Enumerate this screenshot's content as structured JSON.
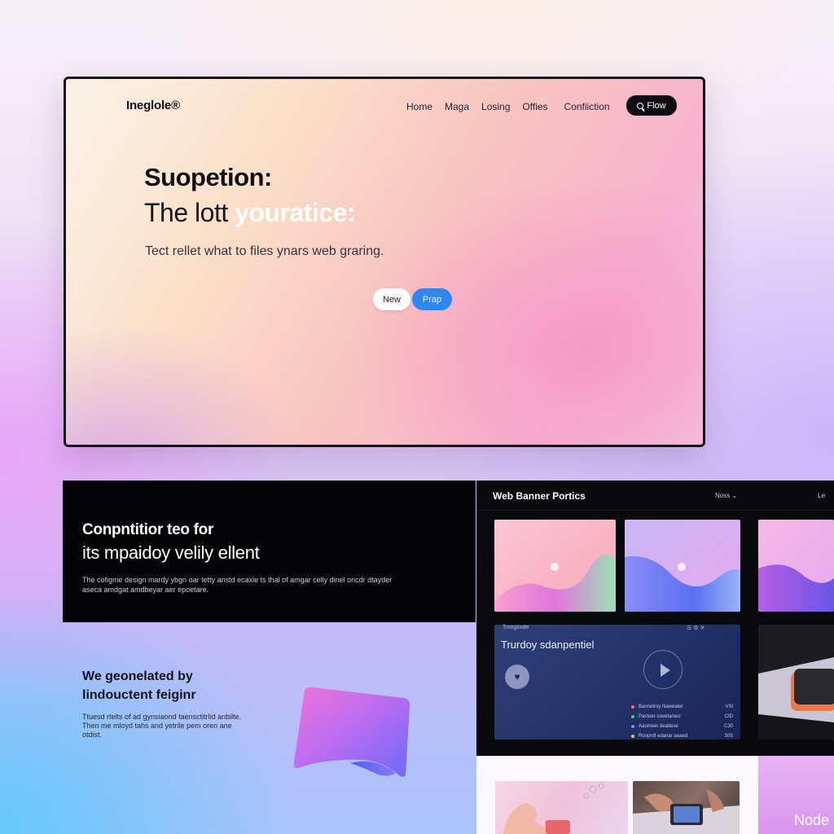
{
  "hero": {
    "logo": "Ineglole®",
    "nav": [
      "Home",
      "Maga",
      "Losing",
      "Offies",
      "Confiiction"
    ],
    "cta": "Flow",
    "title_line1": "Suopetion:",
    "title_line2_plain": "The lott ",
    "title_line2_accent": "youratice:",
    "subtitle": "Tect rellet what to files ynars web graring.",
    "btn_new": "New",
    "btn_prap": "Prap"
  },
  "banner": {
    "title_line1": "Conpntitior teo for",
    "title_line2": "its mpaidoy velily ellent",
    "body": "The cofigme design mardy ybgn oar tetty anstd ecaxle ts thal of amgar celly dinel oncdr dtayder aseca amdgat amdbeyar aer epoetare."
  },
  "bottom_left": {
    "title_line1": "We geonelated by",
    "title_line2": "lindouctent feiginr",
    "body": "Ttuesd rtelts of ad gynsiaond taensctitrlid anbilte. Then me mloyd tahs and yetrile pem oren ane otdist."
  },
  "panel": {
    "title": "Web Banner Portics",
    "menu": "Noss ⌄",
    "right_label": "Le",
    "media": {
      "top_label": "Tinegtoide",
      "title": "Trurdoy sdanpentiel",
      "rows": [
        {
          "label": "Bannetroy Naewater",
          "value": "VSI",
          "color": "#f06a8a"
        },
        {
          "label": "Pactoer rowetanecr",
          "value": "CID",
          "color": "#3fd18f"
        },
        {
          "label": "Aaomeer dealtese",
          "value": "C30",
          "color": "#5aa0f5"
        },
        {
          "label": "Rooprdt edanar aeaed",
          "value": "30S",
          "color": "#f0c25a"
        }
      ]
    }
  },
  "node_label": "Node",
  "colors": {
    "accent_blue": "#2f87f2",
    "dark": "#0a090c"
  }
}
